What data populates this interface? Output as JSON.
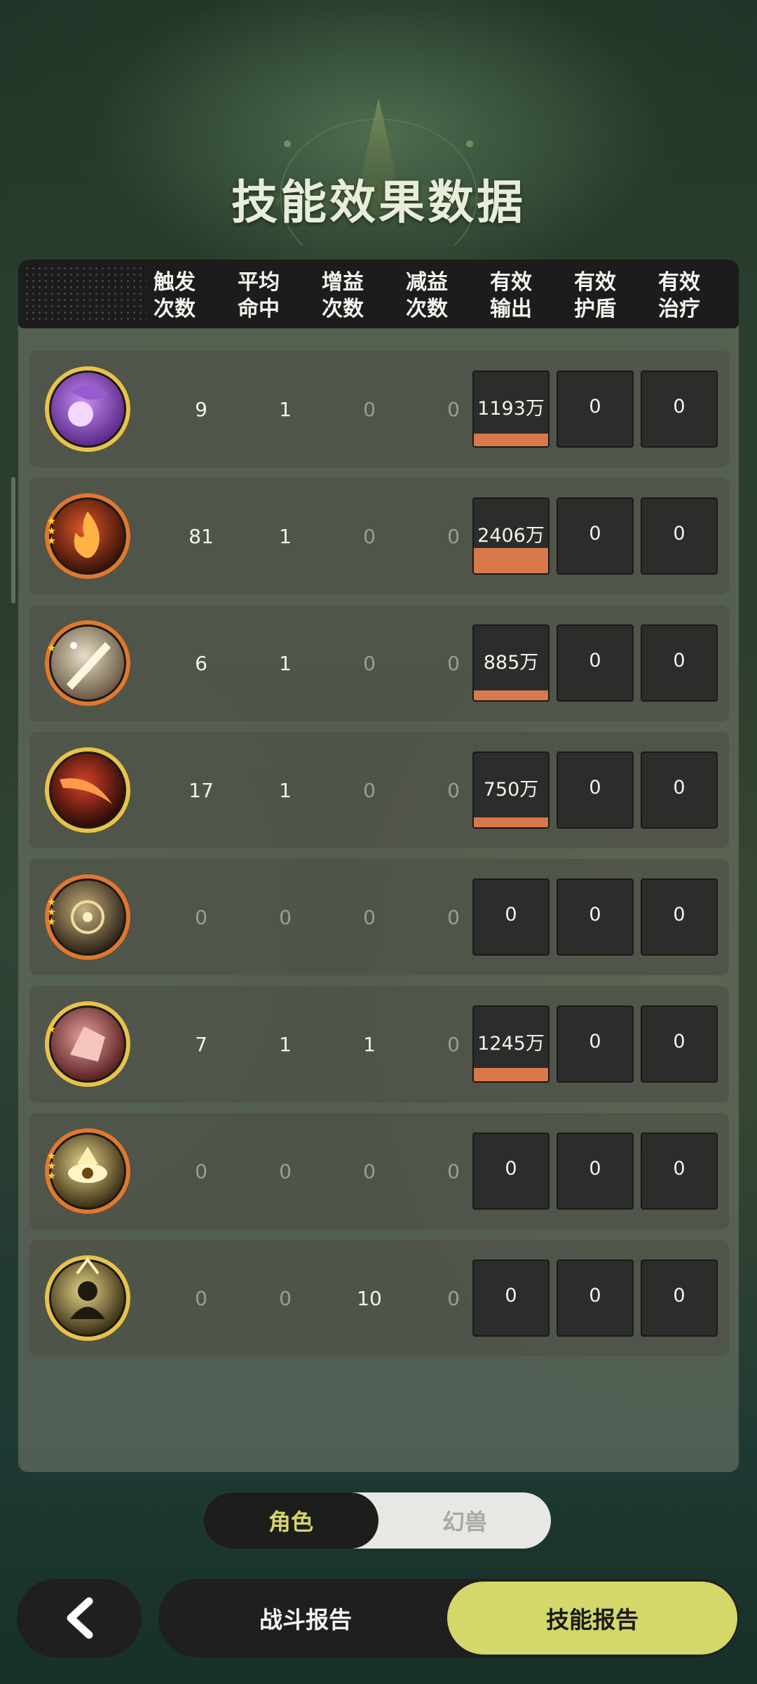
{
  "title": "技能效果数据",
  "columns": [
    {
      "line1": "触发",
      "line2": "次数"
    },
    {
      "line1": "平均",
      "line2": "命中"
    },
    {
      "line1": "增益",
      "line2": "次数"
    },
    {
      "line1": "减益",
      "line2": "次数"
    },
    {
      "line1": "有效",
      "line2": "输出"
    },
    {
      "line1": "有效",
      "line2": "护盾"
    },
    {
      "line1": "有效",
      "line2": "治疗"
    }
  ],
  "rows": [
    {
      "icon": "purple-orb-skill-icon",
      "trigger": "9",
      "avg_hit": "1",
      "buff": "0",
      "debuff": "0",
      "output": "1193万",
      "output_share": 0.5,
      "shield": "0",
      "heal": "0"
    },
    {
      "icon": "flame-skill-icon",
      "trigger": "81",
      "avg_hit": "1",
      "buff": "0",
      "debuff": "0",
      "output": "2406万",
      "output_share": 1.0,
      "shield": "0",
      "heal": "0"
    },
    {
      "icon": "sword-burst-skill-icon",
      "trigger": "6",
      "avg_hit": "1",
      "buff": "0",
      "debuff": "0",
      "output": "885万",
      "output_share": 0.37,
      "shield": "0",
      "heal": "0"
    },
    {
      "icon": "fire-slash-skill-icon",
      "trigger": "17",
      "avg_hit": "1",
      "buff": "0",
      "debuff": "0",
      "output": "750万",
      "output_share": 0.31,
      "shield": "0",
      "heal": "0"
    },
    {
      "icon": "vortex-eye-skill-icon",
      "trigger": "0",
      "avg_hit": "0",
      "buff": "0",
      "debuff": "0",
      "output": "0",
      "output_share": 0,
      "shield": "0",
      "heal": "0"
    },
    {
      "icon": "flesh-shard-skill-icon",
      "trigger": "7",
      "avg_hit": "1",
      "buff": "1",
      "debuff": "0",
      "output": "1245万",
      "output_share": 0.52,
      "shield": "0",
      "heal": "0"
    },
    {
      "icon": "watching-eye-skill-icon",
      "trigger": "0",
      "avg_hit": "0",
      "buff": "0",
      "debuff": "0",
      "output": "0",
      "output_share": 0,
      "shield": "0",
      "heal": "0"
    },
    {
      "icon": "shadow-figure-skill-icon",
      "trigger": "0",
      "avg_hit": "0",
      "buff": "10",
      "debuff": "0",
      "output": "0",
      "output_share": 0,
      "shield": "0",
      "heal": "0"
    }
  ],
  "toggle": {
    "active": "角色",
    "inactive": "幻兽"
  },
  "bottom": {
    "tab_battle": "战斗报告",
    "tab_skill": "技能报告"
  },
  "colors": {
    "accent": "#d4d76a",
    "bar": "#d9784a"
  }
}
